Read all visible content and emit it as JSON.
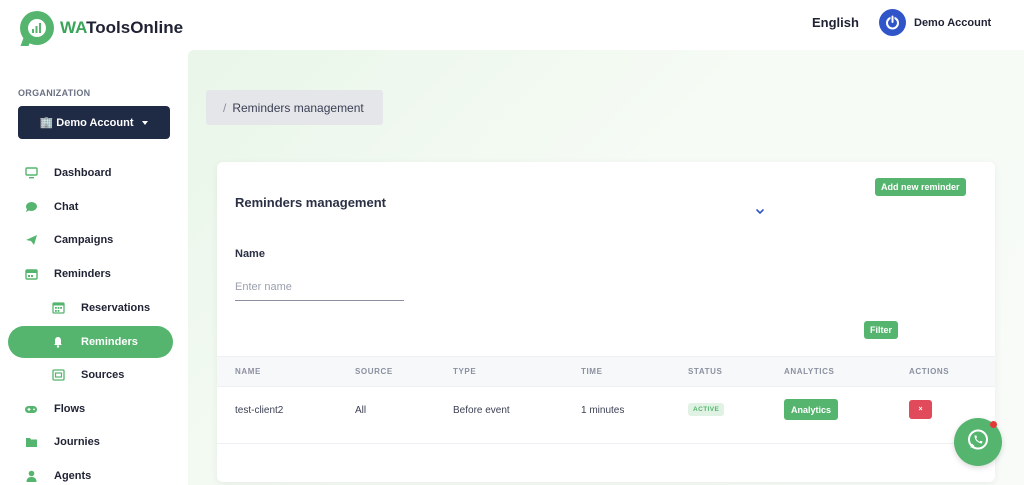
{
  "brand": {
    "name_prefix": "WA",
    "name_suffix": "ToolsOnline"
  },
  "header": {
    "language": "English",
    "account": "Demo Account"
  },
  "sidebar": {
    "org_label": "ORGANIZATION",
    "org_button": "🏢 Demo Account",
    "items": [
      {
        "label": "Dashboard",
        "icon": "monitor-icon"
      },
      {
        "label": "Chat",
        "icon": "chat-bubble-icon"
      },
      {
        "label": "Campaigns",
        "icon": "paper-plane-icon"
      },
      {
        "label": "Reminders",
        "icon": "calendar-icon"
      },
      {
        "label": "Reservations",
        "icon": "calendar-grid-icon"
      },
      {
        "label": "Reminders",
        "icon": "bell-icon",
        "active": true
      },
      {
        "label": "Sources",
        "icon": "list-box-icon"
      },
      {
        "label": "Flows",
        "icon": "gamepad-icon"
      },
      {
        "label": "Journies",
        "icon": "folder-icon"
      },
      {
        "label": "Agents",
        "icon": "user-icon"
      }
    ]
  },
  "breadcrumb": {
    "separator": "/",
    "current": "Reminders management"
  },
  "card": {
    "title": "Reminders management",
    "add_button": "Add new reminder",
    "filter": {
      "name_label": "Name",
      "name_placeholder": "Enter name",
      "filter_button": "Filter"
    },
    "table": {
      "headers": [
        "NAME",
        "SOURCE",
        "TYPE",
        "TIME",
        "STATUS",
        "ANALYTICS",
        "ACTIONS"
      ],
      "rows": [
        {
          "name": "test-client2",
          "source": "All",
          "type": "Before event",
          "time": "1 minutes",
          "status": "ACTIVE",
          "analytics": "Analytics",
          "action": "×"
        }
      ]
    }
  },
  "colors": {
    "accent": "#55b56e",
    "dark": "#1f2a44",
    "danger": "#e04a5b",
    "account_blue": "#2f55c9"
  },
  "floating": {
    "icon": "whatsapp-icon"
  }
}
